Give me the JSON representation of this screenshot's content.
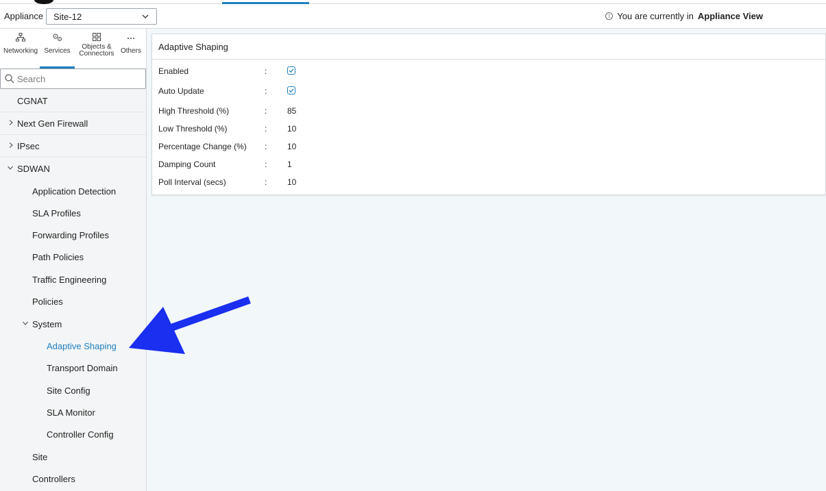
{
  "appliance_bar": {
    "label": "Appliance",
    "selected_site": "Site-12",
    "info_prefix": "You are currently in",
    "info_bold": "Appliance View"
  },
  "nav_tabs": [
    {
      "label": "Networking",
      "icon": "network-icon"
    },
    {
      "label": "Services",
      "icon": "gears-icon"
    },
    {
      "label": "Objects & Connectors",
      "icon": "grid-icon"
    },
    {
      "label": "Others",
      "icon": "more-icon"
    }
  ],
  "search": {
    "placeholder": "Search"
  },
  "tree": {
    "cgnat": "CGNAT",
    "ngfw": "Next Gen Firewall",
    "ipsec": "IPsec",
    "sdwan": "SDWAN",
    "app_detection": "Application Detection",
    "sla_profiles": "SLA Profiles",
    "forwarding_profiles": "Forwarding Profiles",
    "path_policies": "Path Policies",
    "traffic_engineering": "Traffic Engineering",
    "policies": "Policies",
    "system": "System",
    "adaptive_shaping": "Adaptive Shaping",
    "transport_domain": "Transport Domain",
    "site_config": "Site Config",
    "sla_monitor": "SLA Monitor",
    "controller_config": "Controller Config",
    "site": "Site",
    "controllers": "Controllers"
  },
  "panel": {
    "title": "Adaptive Shaping",
    "separator": ":",
    "fields": {
      "enabled": {
        "label": "Enabled",
        "checked": true
      },
      "auto_update": {
        "label": "Auto Update",
        "checked": true
      },
      "high_threshold": {
        "label": "High Threshold (%)",
        "value": "85"
      },
      "low_threshold": {
        "label": "Low Threshold (%)",
        "value": "10"
      },
      "percentage_change": {
        "label": "Percentage Change (%)",
        "value": "10"
      },
      "damping_count": {
        "label": "Damping Count",
        "value": "1"
      },
      "poll_interval": {
        "label": "Poll Interval (secs)",
        "value": "10"
      }
    }
  },
  "colors": {
    "accent": "#1f7fbf",
    "annotation_arrow": "#1a2ff0"
  }
}
